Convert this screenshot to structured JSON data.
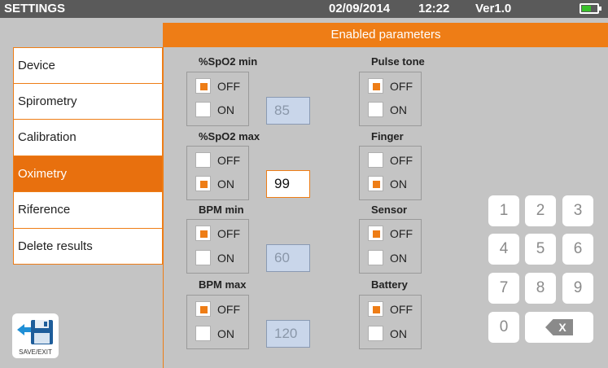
{
  "topbar": {
    "title": "SETTINGS",
    "date": "02/09/2014",
    "time": "12:22",
    "version": "Ver1.0",
    "battery_level": 0.55,
    "battery_color": "#39c02b"
  },
  "panel": {
    "header": "Enabled parameters"
  },
  "menu": {
    "items": [
      {
        "label": "Device"
      },
      {
        "label": "Spirometry"
      },
      {
        "label": "Calibration"
      },
      {
        "label": "Oximetry"
      },
      {
        "label": "Riference"
      },
      {
        "label": "Delete results"
      }
    ],
    "active": "Oximetry"
  },
  "save_exit": {
    "label": "SAVE/EXIT",
    "icon": "floppy-disk-icon"
  },
  "params": {
    "spo2_min": {
      "label": "%SpO2 min",
      "off": "OFF",
      "on": "ON",
      "selected": "OFF",
      "value": "85"
    },
    "spo2_max": {
      "label": "%SpO2 max",
      "off": "OFF",
      "on": "ON",
      "selected": "ON",
      "value": "99"
    },
    "bpm_min": {
      "label": "BPM min",
      "off": "OFF",
      "on": "ON",
      "selected": "OFF",
      "value": "60"
    },
    "bpm_max": {
      "label": "BPM max",
      "off": "OFF",
      "on": "ON",
      "selected": "OFF",
      "value": "120"
    },
    "pulse_tone": {
      "label": "Pulse tone",
      "off": "OFF",
      "on": "ON",
      "selected": "OFF"
    },
    "finger": {
      "label": "Finger",
      "off": "OFF",
      "on": "ON",
      "selected": "ON"
    },
    "sensor": {
      "label": "Sensor",
      "off": "OFF",
      "on": "ON",
      "selected": "OFF"
    },
    "battery": {
      "label": "Battery",
      "off": "OFF",
      "on": "ON",
      "selected": "OFF"
    }
  },
  "numpad": {
    "keys": [
      "1",
      "2",
      "3",
      "4",
      "5",
      "6",
      "7",
      "8",
      "9",
      "0"
    ],
    "backspace_label": "X"
  },
  "colors": {
    "accent": "#ee7d16",
    "active_menu": "#e8700e",
    "statusbar": "#5a5a5a",
    "background": "#c4c4c4"
  }
}
